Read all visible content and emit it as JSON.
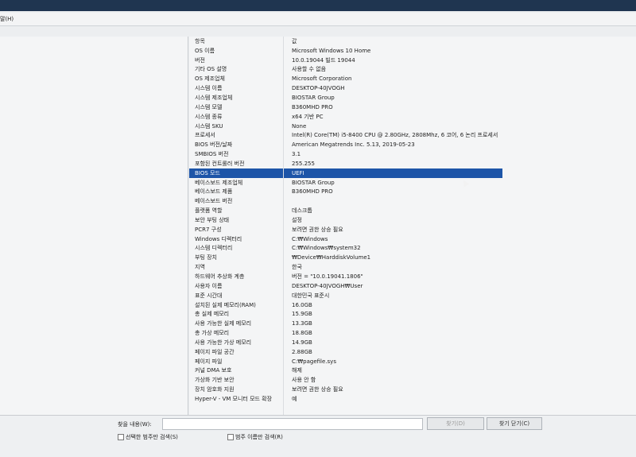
{
  "menu": {
    "help": "말(H)"
  },
  "header": {
    "item": "항목",
    "value": "값"
  },
  "rows": [
    {
      "k": "OS 이름",
      "v": "Microsoft Windows 10 Home"
    },
    {
      "k": "버전",
      "v": "10.0.19044 빌드 19044"
    },
    {
      "k": "기타 OS 설명",
      "v": "사용할 수 없음"
    },
    {
      "k": "OS 제조업체",
      "v": "Microsoft Corporation"
    },
    {
      "k": "시스템 이름",
      "v": "DESKTOP-40JVOGH"
    },
    {
      "k": "시스템 제조업체",
      "v": "BIOSTAR Group"
    },
    {
      "k": "시스템 모델",
      "v": "B360MHD PRO"
    },
    {
      "k": "시스템 종류",
      "v": "x64 기반 PC"
    },
    {
      "k": "시스템 SKU",
      "v": "None"
    },
    {
      "k": "프로세서",
      "v": "Intel(R) Core(TM) i5-8400 CPU @ 2.80GHz, 2808Mhz, 6 코어, 6 논리 프로세서"
    },
    {
      "k": "BIOS 버전/날짜",
      "v": "American Megatrends Inc. 5.13, 2019-05-23"
    },
    {
      "k": "SMBIOS 버전",
      "v": "3.1"
    },
    {
      "k": "포함된 컨트롤러 버전",
      "v": "255.255"
    },
    {
      "k": "BIOS 모드",
      "v": "UEFI"
    },
    {
      "k": "베이스보드 제조업체",
      "v": "BIOSTAR Group"
    },
    {
      "k": "베이스보드 제품",
      "v": "B360MHD PRO"
    },
    {
      "k": "베이스보드 버전",
      "v": ""
    },
    {
      "k": "플랫폼 역할",
      "v": "데스크톱"
    },
    {
      "k": "보안 부팅 상태",
      "v": "설정"
    },
    {
      "k": "PCR7 구성",
      "v": "보려면 권한 상승 필요"
    },
    {
      "k": "Windows 디렉터리",
      "v": "C:₩Windows"
    },
    {
      "k": "시스템 디렉터리",
      "v": "C:₩Windows₩system32"
    },
    {
      "k": "부팅 장치",
      "v": "₩Device₩HarddiskVolume1"
    },
    {
      "k": "지역",
      "v": "한국"
    },
    {
      "k": "하드웨어 추상화 계층",
      "v": "버전 = \"10.0.19041.1806\""
    },
    {
      "k": "사용자 이름",
      "v": "DESKTOP-40JVOGH₩User"
    },
    {
      "k": "표준 시간대",
      "v": "대한민국 표준시"
    },
    {
      "k": "설치된 실제 메모리(RAM)",
      "v": "16.0GB"
    },
    {
      "k": "총 실제 메모리",
      "v": "15.9GB"
    },
    {
      "k": "사용 가능한 실제 메모리",
      "v": "13.3GB"
    },
    {
      "k": "총 가상 메모리",
      "v": "18.8GB"
    },
    {
      "k": "사용 가능한 가상 메모리",
      "v": "14.9GB"
    },
    {
      "k": "페이지 파일 공간",
      "v": "2.88GB"
    },
    {
      "k": "페이지 파일",
      "v": "C:₩pagefile.sys"
    },
    {
      "k": "커널 DMA 보호",
      "v": "해제"
    },
    {
      "k": "가상화 기반 보안",
      "v": "사용 안 함"
    },
    {
      "k": "장치 암호화 지원",
      "v": "보려면 권한 상승 필요"
    },
    {
      "k": "Hyper-V - VM 모니터 모드 확장",
      "v": "예"
    }
  ],
  "selected_row": 13,
  "search": {
    "label": "찾을 내용(W):",
    "value": "",
    "find_button": "찾기(D)",
    "close_button": "찾기 닫기(C)",
    "check_selected": "선택한 범주만 검색(S)",
    "check_names": "범주 이름만 검색(R)"
  },
  "colors": {
    "selection": "#1d55a8"
  }
}
